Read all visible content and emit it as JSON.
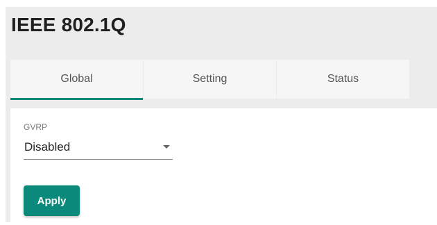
{
  "page": {
    "title": "IEEE 802.1Q"
  },
  "tabs": [
    {
      "label": "Global",
      "active": true
    },
    {
      "label": "Setting",
      "active": false
    },
    {
      "label": "Status",
      "active": false
    }
  ],
  "form": {
    "gvrp": {
      "label": "GVRP",
      "value": "Disabled"
    },
    "apply_label": "Apply"
  },
  "colors": {
    "accent": "#00897b",
    "button": "#0b8a7b",
    "background": "#ececec"
  }
}
